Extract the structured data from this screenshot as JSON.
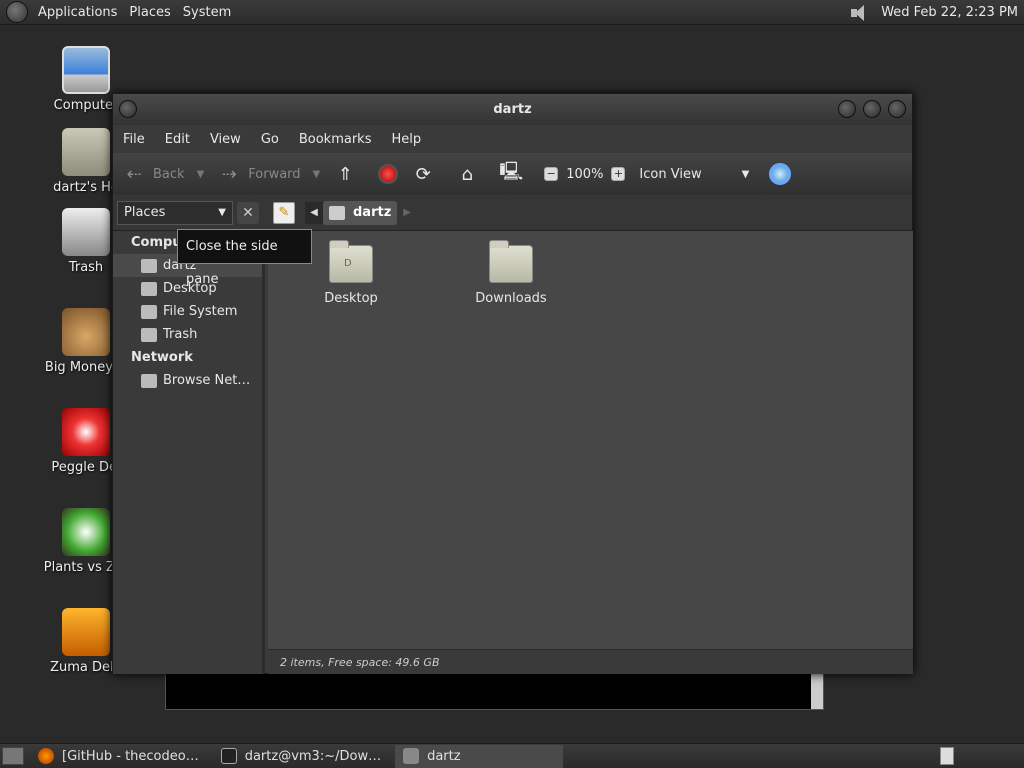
{
  "top_panel": {
    "menus": [
      "Applications",
      "Places",
      "System"
    ],
    "clock": "Wed Feb 22,  2:23 PM"
  },
  "desktop_icons": [
    {
      "label": "Computer",
      "icon": "computer-icon"
    },
    {
      "label": "dartz's Ho",
      "icon": "home-folder-icon"
    },
    {
      "label": "Trash",
      "icon": "trash-icon"
    },
    {
      "label": "Big Money D",
      "icon": "money-bag-icon"
    },
    {
      "label": "Peggle Del",
      "icon": "peggle-icon"
    },
    {
      "label": "Plants vs Zor",
      "icon": "plants-icon"
    },
    {
      "label": "Zuma Delu",
      "icon": "zuma-icon"
    }
  ],
  "window": {
    "title": "dartz",
    "menu": [
      "File",
      "Edit",
      "View",
      "Go",
      "Bookmarks",
      "Help"
    ],
    "toolbar": {
      "back": "Back",
      "forward": "Forward",
      "zoom": "100%",
      "view": "Icon View"
    },
    "location": {
      "places_label": "Places",
      "crumb": "dartz"
    },
    "side_pane": {
      "computer_header": "Compu",
      "items": [
        "dartz",
        "Desktop",
        "File System",
        "Trash"
      ],
      "network_header": "Network",
      "network_items": [
        "Browse Net…"
      ]
    },
    "files": [
      {
        "name": "Desktop"
      },
      {
        "name": "Downloads"
      }
    ],
    "status": "2 items, Free space: 49.6 GB",
    "tooltip": "Close the side pane"
  },
  "taskbar": {
    "tasks": [
      "[GitHub - thecodeo…",
      "dartz@vm3:~/Dow…",
      "dartz"
    ]
  },
  "colors": {
    "panel": "#2c2c2c",
    "window_bg": "#3a3a3a",
    "content_bg": "#474747"
  }
}
